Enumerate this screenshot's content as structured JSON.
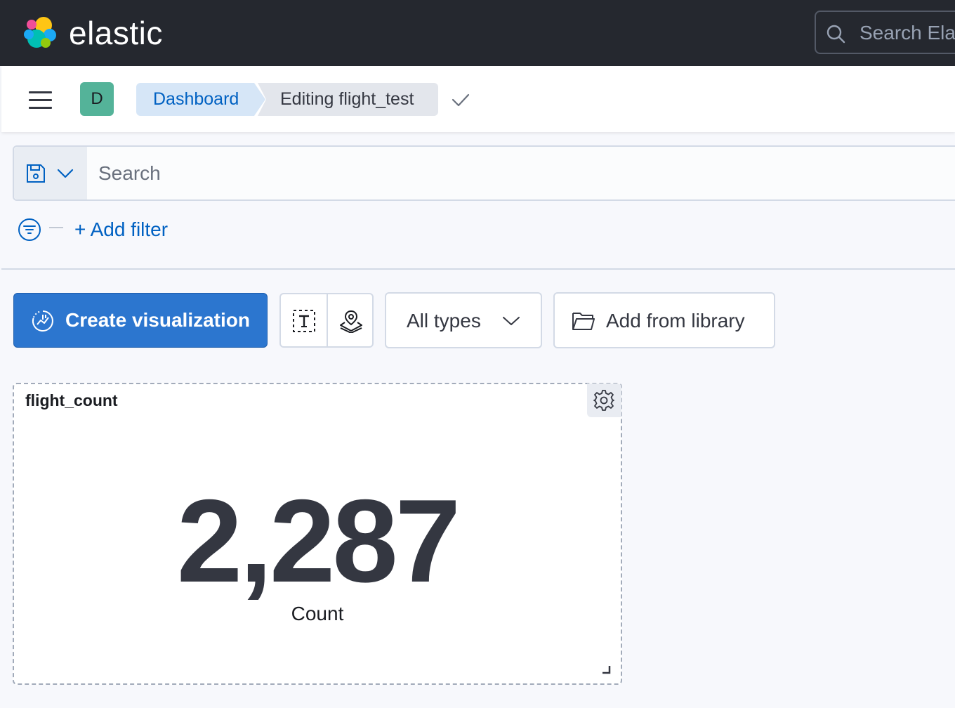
{
  "topbar": {
    "logo_text": "elastic",
    "search_placeholder": "Search Ela",
    "background": "#25282f"
  },
  "header": {
    "avatar_initial": "D",
    "avatar_color": "#54b399",
    "breadcrumbs": [
      {
        "label": "Dashboard"
      },
      {
        "label": "Editing flight_test"
      }
    ]
  },
  "querybar": {
    "placeholder": "Search"
  },
  "filters": {
    "add_filter_label": "+ Add filter"
  },
  "toolbar": {
    "create_label": "Create visualization",
    "types_label": "All types",
    "library_label": "Add from library",
    "accent": "#2c76cf"
  },
  "panel": {
    "title": "flight_count",
    "metric_value": "2,287",
    "metric_label": "Count"
  }
}
